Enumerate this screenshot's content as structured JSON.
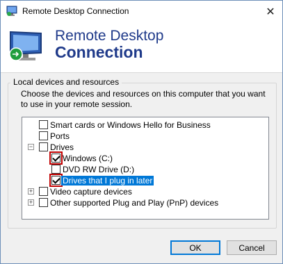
{
  "window": {
    "title": "Remote Desktop Connection",
    "close_glyph": "✕"
  },
  "banner": {
    "line1": "Remote Desktop",
    "line2": "Connection"
  },
  "group": {
    "label": "Local devices and resources",
    "description": "Choose the devices and resources on this computer that you want to use in your remote session."
  },
  "tree": {
    "items": [
      {
        "label": "Smart cards or Windows Hello for Business",
        "checked": false
      },
      {
        "label": "Ports",
        "checked": false
      },
      {
        "label": "Drives",
        "checked": false,
        "expander": "−"
      },
      {
        "label": "Windows (C:)",
        "checked": true
      },
      {
        "label": "DVD RW Drive (D:)",
        "checked": false
      },
      {
        "label": "Drives that I plug in later",
        "checked": true,
        "selected": true
      },
      {
        "label": "Video capture devices",
        "checked": false,
        "expander": "+"
      },
      {
        "label": "Other supported Plug and Play (PnP) devices",
        "checked": false,
        "expander": "+"
      }
    ]
  },
  "buttons": {
    "ok": "OK",
    "cancel": "Cancel"
  },
  "colors": {
    "title_blue": "#1f3a8a",
    "selection": "#0078d7",
    "highlight_box": "#c00000"
  }
}
